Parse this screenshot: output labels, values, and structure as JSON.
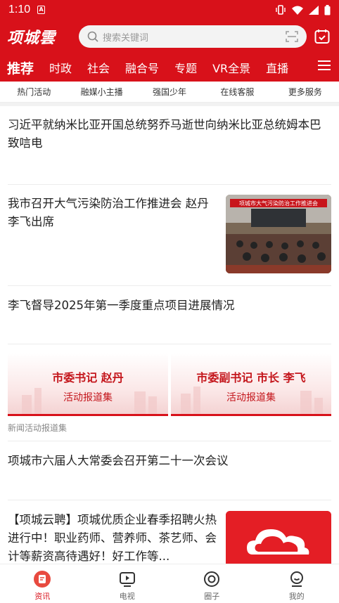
{
  "status": {
    "time": "1:10",
    "badge": "A"
  },
  "app": {
    "logo": "项城雲"
  },
  "search": {
    "placeholder": "搜索关键词"
  },
  "nav_tabs": [
    "推荐",
    "时政",
    "社会",
    "融合号",
    "专题",
    "VR全景",
    "直播"
  ],
  "quick_links": [
    "热门活动",
    "融媒小主播",
    "强国少年",
    "在线客服",
    "更多服务"
  ],
  "news": [
    {
      "title": "习近平就纳米比亚开国总统努乔马逝世向纳米比亚总统姆本巴致唁电"
    },
    {
      "title": "我市召开大气污染防治工作推进会 赵丹 李飞出席"
    },
    {
      "title": "李飞督导2025年第一季度重点项目进展情况"
    },
    {
      "title": "项城市六届人大常委会召开第二十一次会议"
    },
    {
      "title": "【项城云聘】项城优质企业春季招聘火热进行中！职业药师、营养师、茶艺师、会计等薪资高待遇好！好工作等..."
    }
  ],
  "banners": [
    {
      "title": "市委书记 赵丹",
      "subtitle": "活动报道集"
    },
    {
      "title": "市委副书记 市长 李飞",
      "subtitle": "活动报道集"
    }
  ],
  "banner_caption": "新闻活动报道集",
  "photo_caption": "项城市大气污染防治工作推进会",
  "tabs": [
    {
      "label": "资讯",
      "icon": "news-icon"
    },
    {
      "label": "电视",
      "icon": "tv-icon"
    },
    {
      "label": "圈子",
      "icon": "circle-icon"
    },
    {
      "label": "我的",
      "icon": "profile-icon"
    }
  ],
  "colors": {
    "brand": "#d8111a",
    "accent_text": "#c4161c"
  }
}
